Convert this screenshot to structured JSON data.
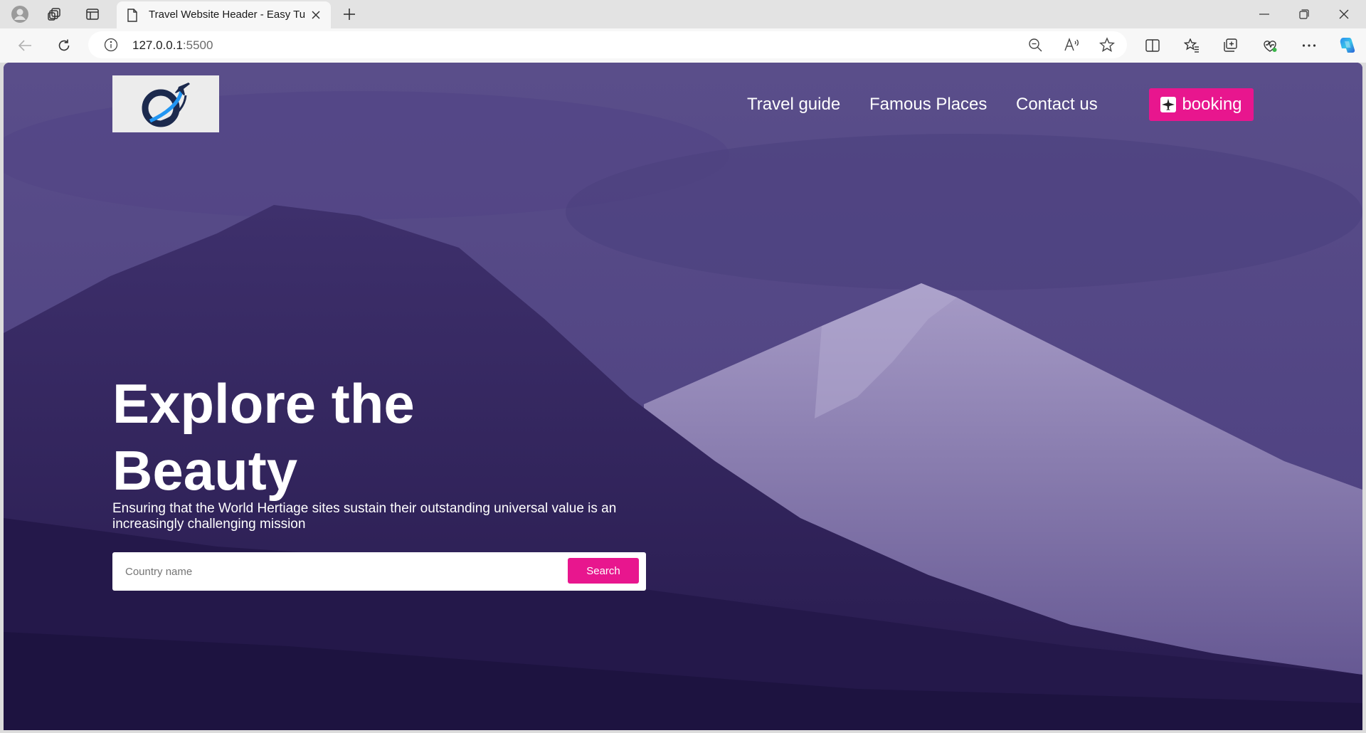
{
  "browser": {
    "tab_title": "Travel Website Header - Easy Tut",
    "url_host": "127.0.0.1",
    "url_port": ":5500"
  },
  "nav": {
    "links": [
      "Travel guide",
      "Famous Places",
      "Contact us"
    ],
    "booking_label": "booking"
  },
  "hero": {
    "title_line1": "Explore the",
    "title_line2": "Beauty",
    "subtitle": "Ensuring that the World Hertiage sites sustain their outstanding universal value is an increasingly challenging mission"
  },
  "search": {
    "placeholder": "Country name",
    "button_label": "Search"
  },
  "colors": {
    "accent": "#e8168e",
    "overlay": "#3e2480"
  }
}
